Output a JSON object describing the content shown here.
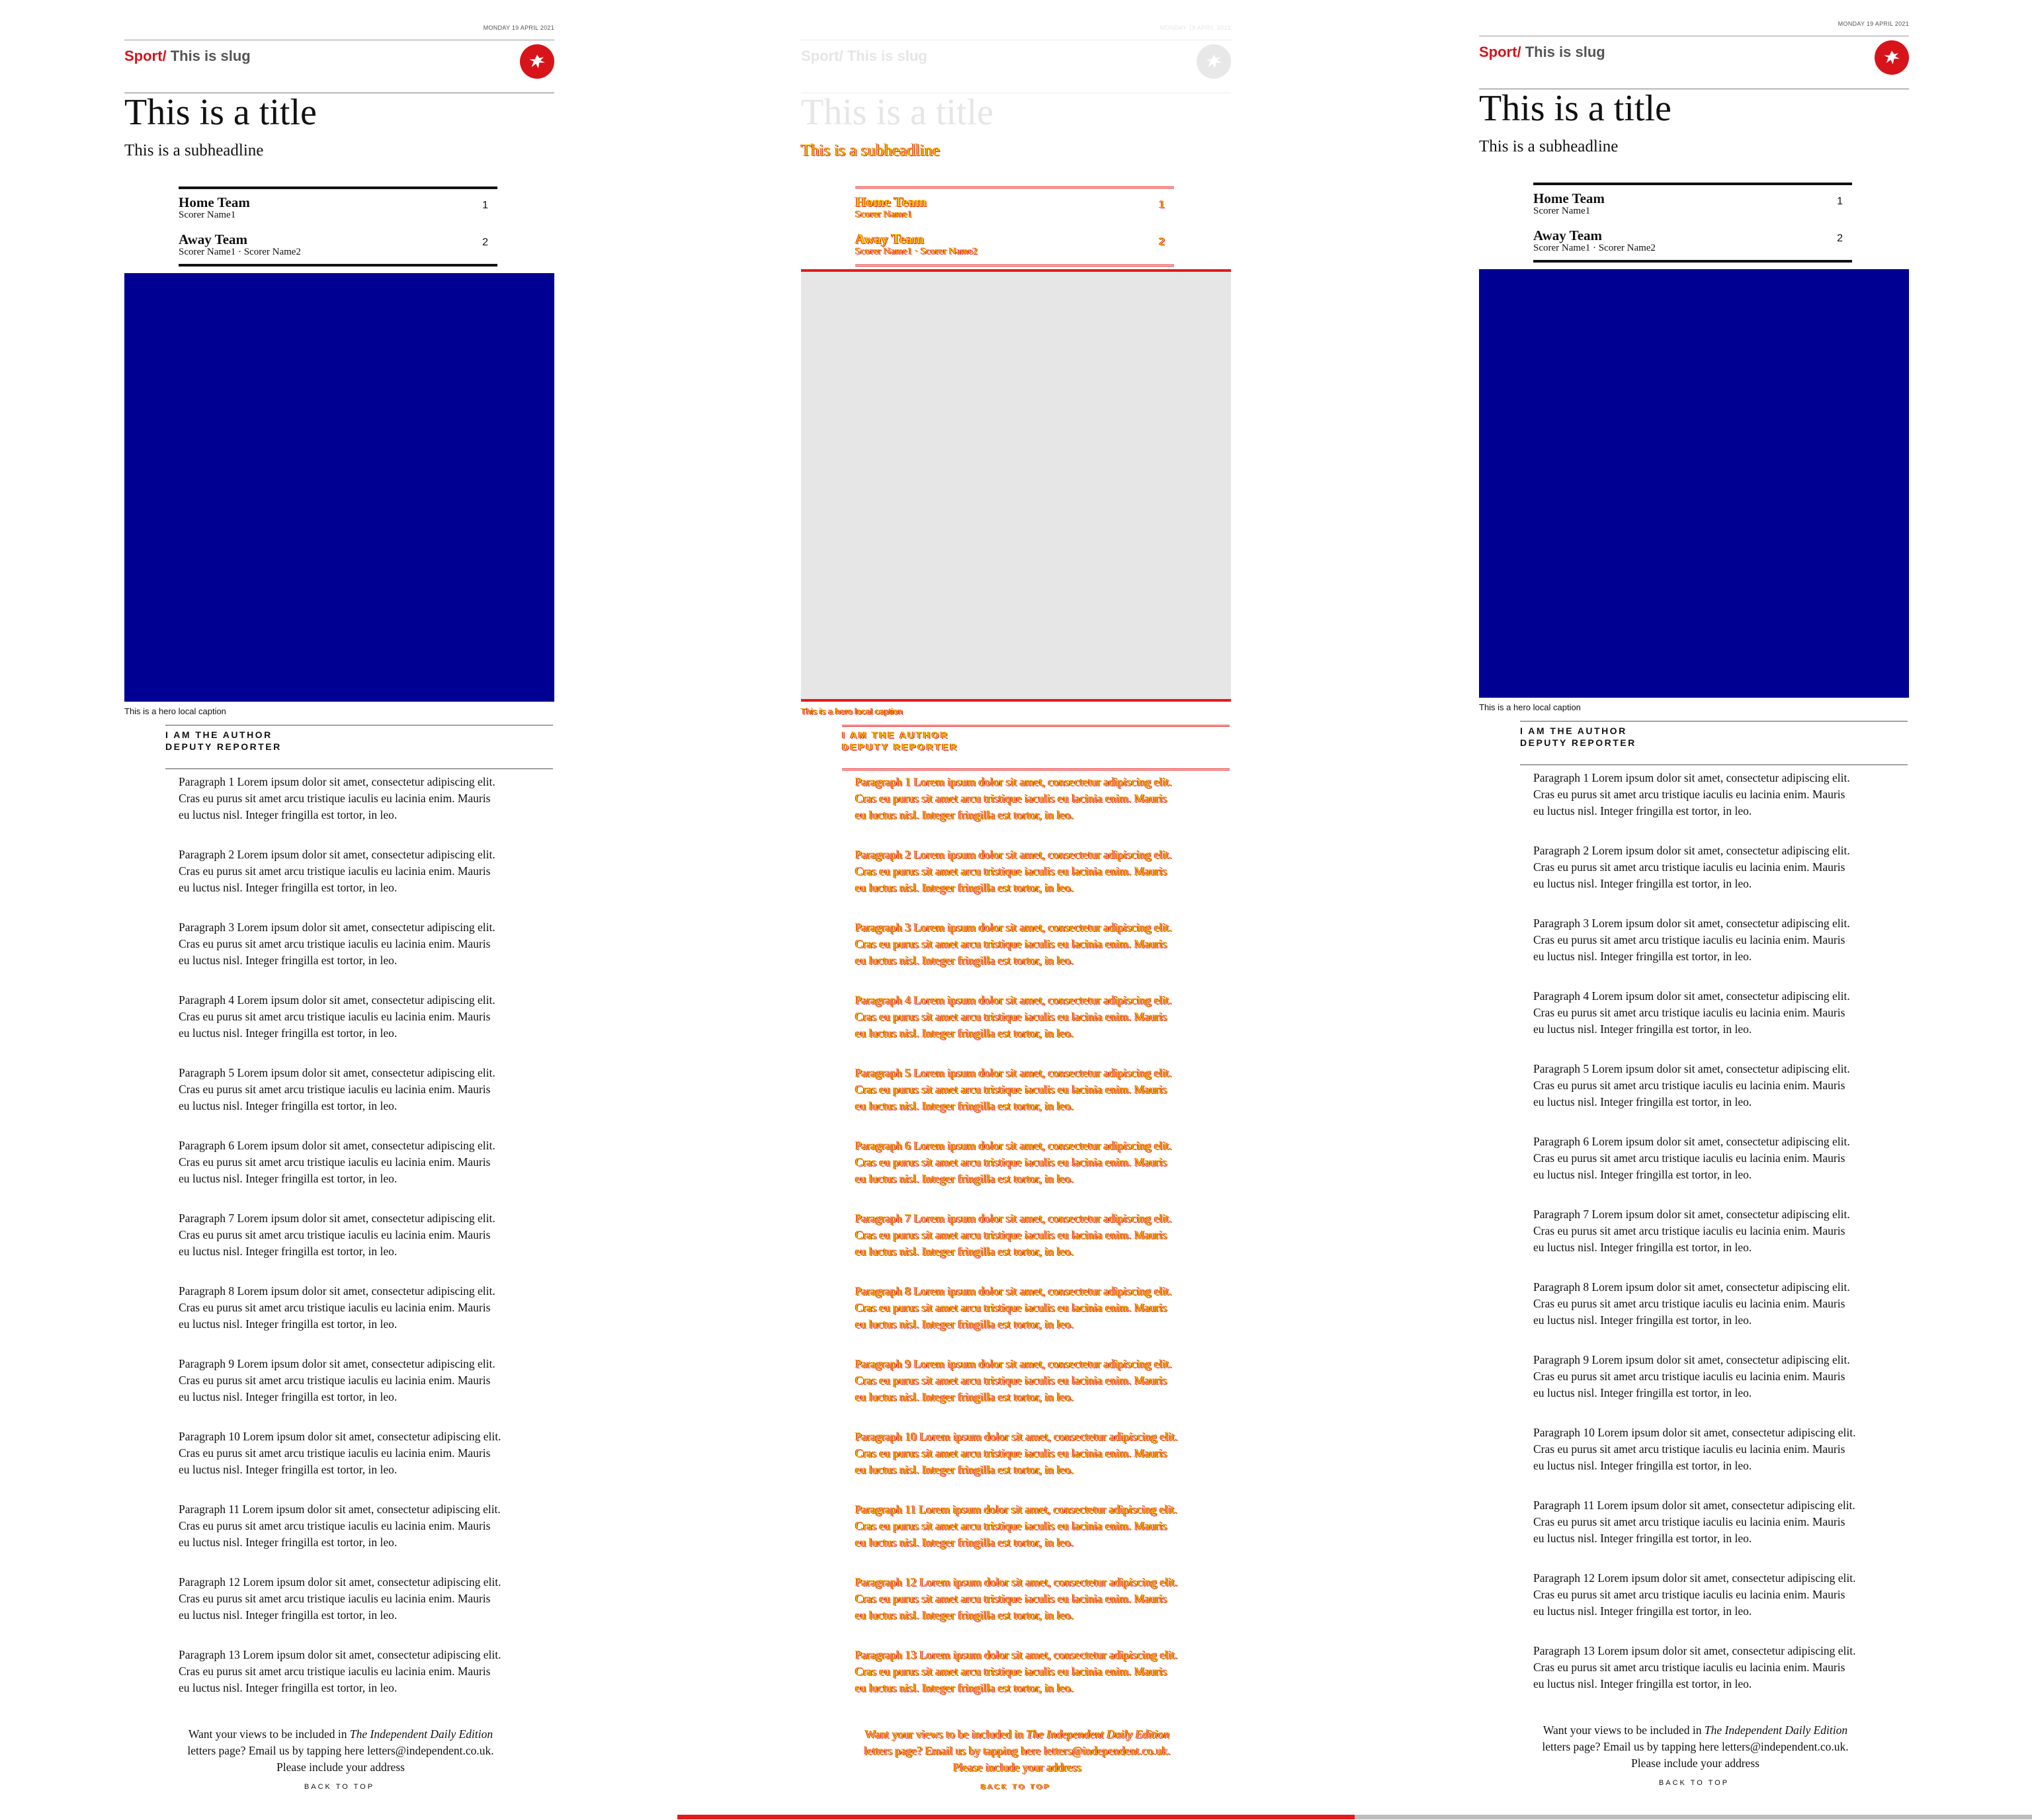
{
  "date": "MONDAY 19 APRIL 2021",
  "slug": {
    "section": "Sport",
    "separator": "/",
    "text": " This is slug"
  },
  "title": "This is a title",
  "subheadline": "This is a subheadline",
  "score": {
    "home": {
      "name": "Home Team",
      "scorers": "Scorer Name1",
      "score": "1"
    },
    "away": {
      "name": "Away Team",
      "scorers": "Scorer Name1 · Scorer Name2",
      "score": "2"
    }
  },
  "hero": {
    "caption": "This is a hero local caption",
    "color": "#000093"
  },
  "author": {
    "name": "I AM THE AUTHOR",
    "role": "DEPUTY REPORTER"
  },
  "paragraphs": [
    "Paragraph 1 Lorem ipsum dolor sit amet, consectetur adipiscing elit. Cras eu purus sit amet arcu tristique iaculis eu lacinia enim. Mauris eu luctus nisl. Integer fringilla est tortor, in leo.",
    "Paragraph 2 Lorem ipsum dolor sit amet, consectetur adipiscing elit. Cras eu purus sit amet arcu tristique iaculis eu lacinia enim. Mauris eu luctus nisl. Integer fringilla est tortor, in leo.",
    "Paragraph 3 Lorem ipsum dolor sit amet, consectetur adipiscing elit. Cras eu purus sit amet arcu tristique iaculis eu lacinia enim. Mauris eu luctus nisl. Integer fringilla est tortor, in leo.",
    "Paragraph 4 Lorem ipsum dolor sit amet, consectetur adipiscing elit. Cras eu purus sit amet arcu tristique iaculis eu lacinia enim. Mauris eu luctus nisl. Integer fringilla est tortor, in leo.",
    "Paragraph 5 Lorem ipsum dolor sit amet, consectetur adipiscing elit. Cras eu purus sit amet arcu tristique iaculis eu lacinia enim. Mauris eu luctus nisl. Integer fringilla est tortor, in leo.",
    "Paragraph 6 Lorem ipsum dolor sit amet, consectetur adipiscing elit. Cras eu purus sit amet arcu tristique iaculis eu lacinia enim. Mauris eu luctus nisl. Integer fringilla est tortor, in leo.",
    "Paragraph 7 Lorem ipsum dolor sit amet, consectetur adipiscing elit. Cras eu purus sit amet arcu tristique iaculis eu lacinia enim. Mauris eu luctus nisl. Integer fringilla est tortor, in leo.",
    "Paragraph 8 Lorem ipsum dolor sit amet, consectetur adipiscing elit. Cras eu purus sit amet arcu tristique iaculis eu lacinia enim. Mauris eu luctus nisl. Integer fringilla est tortor, in leo.",
    "Paragraph 9 Lorem ipsum dolor sit amet, consectetur adipiscing elit. Cras eu purus sit amet arcu tristique iaculis eu lacinia enim. Mauris eu luctus nisl. Integer fringilla est tortor, in leo.",
    "Paragraph 10 Lorem ipsum dolor sit amet, consectetur adipiscing elit. Cras eu purus sit amet arcu tristique iaculis eu lacinia enim. Mauris eu luctus nisl. Integer fringilla est tortor, in leo.",
    "Paragraph 11 Lorem ipsum dolor sit amet, consectetur adipiscing elit. Cras eu purus sit amet arcu tristique iaculis eu lacinia enim. Mauris eu luctus nisl. Integer fringilla est tortor, in leo.",
    "Paragraph 12 Lorem ipsum dolor sit amet, consectetur adipiscing elit. Cras eu purus sit amet arcu tristique iaculis eu lacinia enim. Mauris eu luctus nisl. Integer fringilla est tortor, in leo.",
    "Paragraph 13 Lorem ipsum dolor sit amet, consectetur adipiscing elit. Cras eu purus sit amet arcu tristique iaculis eu lacinia enim. Mauris eu luctus nisl. Integer fringilla est tortor, in leo."
  ],
  "footer": {
    "letters_before": "Want your views to be included in ",
    "letters_publication": "The Independent Daily Edition",
    "letters_after": " letters page? Email us by tapping here letters@independent.co.uk. Please include your address",
    "back_to_top": "BACK TO TOP"
  },
  "progress": {
    "fraction": 0.5
  },
  "icons": {
    "logo": "eagle-logo-icon"
  },
  "colors": {
    "brand": "#d7141a",
    "hero": "#000093",
    "overlay_text": "#f0c800",
    "overlay_outline": "#e41b1b"
  }
}
